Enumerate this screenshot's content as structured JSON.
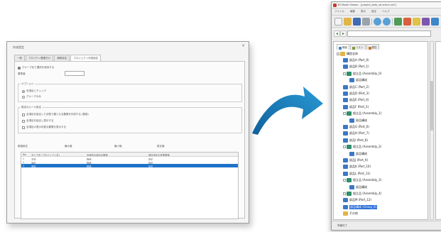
{
  "dialog": {
    "title": "作成設定",
    "close_glyph": "×",
    "tabs": [
      "一般",
      "プロパティ関連付け",
      "補助設定",
      "プロジェクト作成設定"
    ],
    "active_tab": 3,
    "checkbox_main": "グループ化で選択を保持する",
    "field_label": "基準値",
    "field_value": "",
    "group1_label": "オプション",
    "radio1": "全項目にチェック",
    "radio2": "グループのみ",
    "group2_label": "既定のルール設定",
    "check_a": "全項目を結合した状態で親となる要素を作成する (推奨)",
    "check_b": "全項目を結合し表示する",
    "check_c": "全項目の表示可能な要素を表示する",
    "summary_labels": [
      "数値設定",
      "最大値",
      "最小値",
      "設定値"
    ],
    "table_headers": [
      "No.",
      "タイプ名 (プロジェクト名)",
      "全体的な項目の数値",
      "項目設定の変更数値"
    ],
    "table_rows": [
      [
        "1",
        "名前",
        "数値",
        "設定"
      ],
      [
        "2",
        "項目",
        "数値",
        "設定"
      ],
      [
        "3",
        "選択",
        "数値",
        "設定"
      ]
    ],
    "selected_row": 2
  },
  "app": {
    "title": "3D Model Viewer - [project_data_structure.xml]",
    "menus": [
      "ファイル",
      "編集",
      "表示",
      "設定",
      "ヘルプ"
    ],
    "tree_tabs": [
      "構造",
      "リスト",
      "属性"
    ],
    "tree": [
      {
        "label": "構造全体",
        "level": 0,
        "icon": "folder",
        "expander": true
      },
      {
        "label": "部品A (Part_0)",
        "level": 1,
        "icon": "part"
      },
      {
        "label": "部品B (Part_1)",
        "level": 1,
        "icon": "part"
      },
      {
        "label": "組立品 (Assembly_0)",
        "level": 1,
        "icon": "assy",
        "expander": true
      },
      {
        "label": "部品構成",
        "level": 2,
        "icon": "part"
      },
      {
        "label": "部品C (Part_2)",
        "level": 1,
        "icon": "part"
      },
      {
        "label": "部品D (Part_3)",
        "level": 1,
        "icon": "part"
      },
      {
        "label": "部品E (Part_4)",
        "level": 1,
        "icon": "part"
      },
      {
        "label": "部品F (Part_5)",
        "level": 1,
        "icon": "part"
      },
      {
        "label": "組立品 (Assembly_1)",
        "level": 1,
        "icon": "assy",
        "expander": true
      },
      {
        "label": "部品構成",
        "level": 2,
        "icon": "part"
      },
      {
        "label": "部品G (Part_6)",
        "level": 1,
        "icon": "part"
      },
      {
        "label": "部品H (Part_7)",
        "level": 1,
        "icon": "part"
      },
      {
        "label": "部品I (Part_8)",
        "level": 1,
        "icon": "part"
      },
      {
        "label": "組立品 (Assembly_2)",
        "level": 1,
        "icon": "assy",
        "expander": true
      },
      {
        "label": "部品構成",
        "level": 2,
        "icon": "part"
      },
      {
        "label": "部品J (Part_9)",
        "level": 1,
        "icon": "part"
      },
      {
        "label": "部品K (Part_10)",
        "level": 1,
        "icon": "part"
      },
      {
        "label": "部品L (Part_11)",
        "level": 1,
        "icon": "part"
      },
      {
        "label": "組立品 (Assembly_3)",
        "level": 1,
        "icon": "assy",
        "expander": true
      },
      {
        "label": "部品構成",
        "level": 2,
        "icon": "part"
      },
      {
        "label": "組立品 (Assembly_4)",
        "level": 1,
        "icon": "assy",
        "expander": true
      },
      {
        "label": "部品M (Part_12)",
        "level": 1,
        "icon": "part"
      },
      {
        "label": "部品構成 (Group_0)",
        "level": 1,
        "icon": "part",
        "selected": true
      },
      {
        "label": "その他",
        "level": 1,
        "icon": "folder"
      }
    ],
    "status": "準備完了"
  },
  "colors": {
    "accent": "#1e73c8",
    "arrow": "#1d7fb8",
    "tree_select": "#2a6fd6"
  }
}
